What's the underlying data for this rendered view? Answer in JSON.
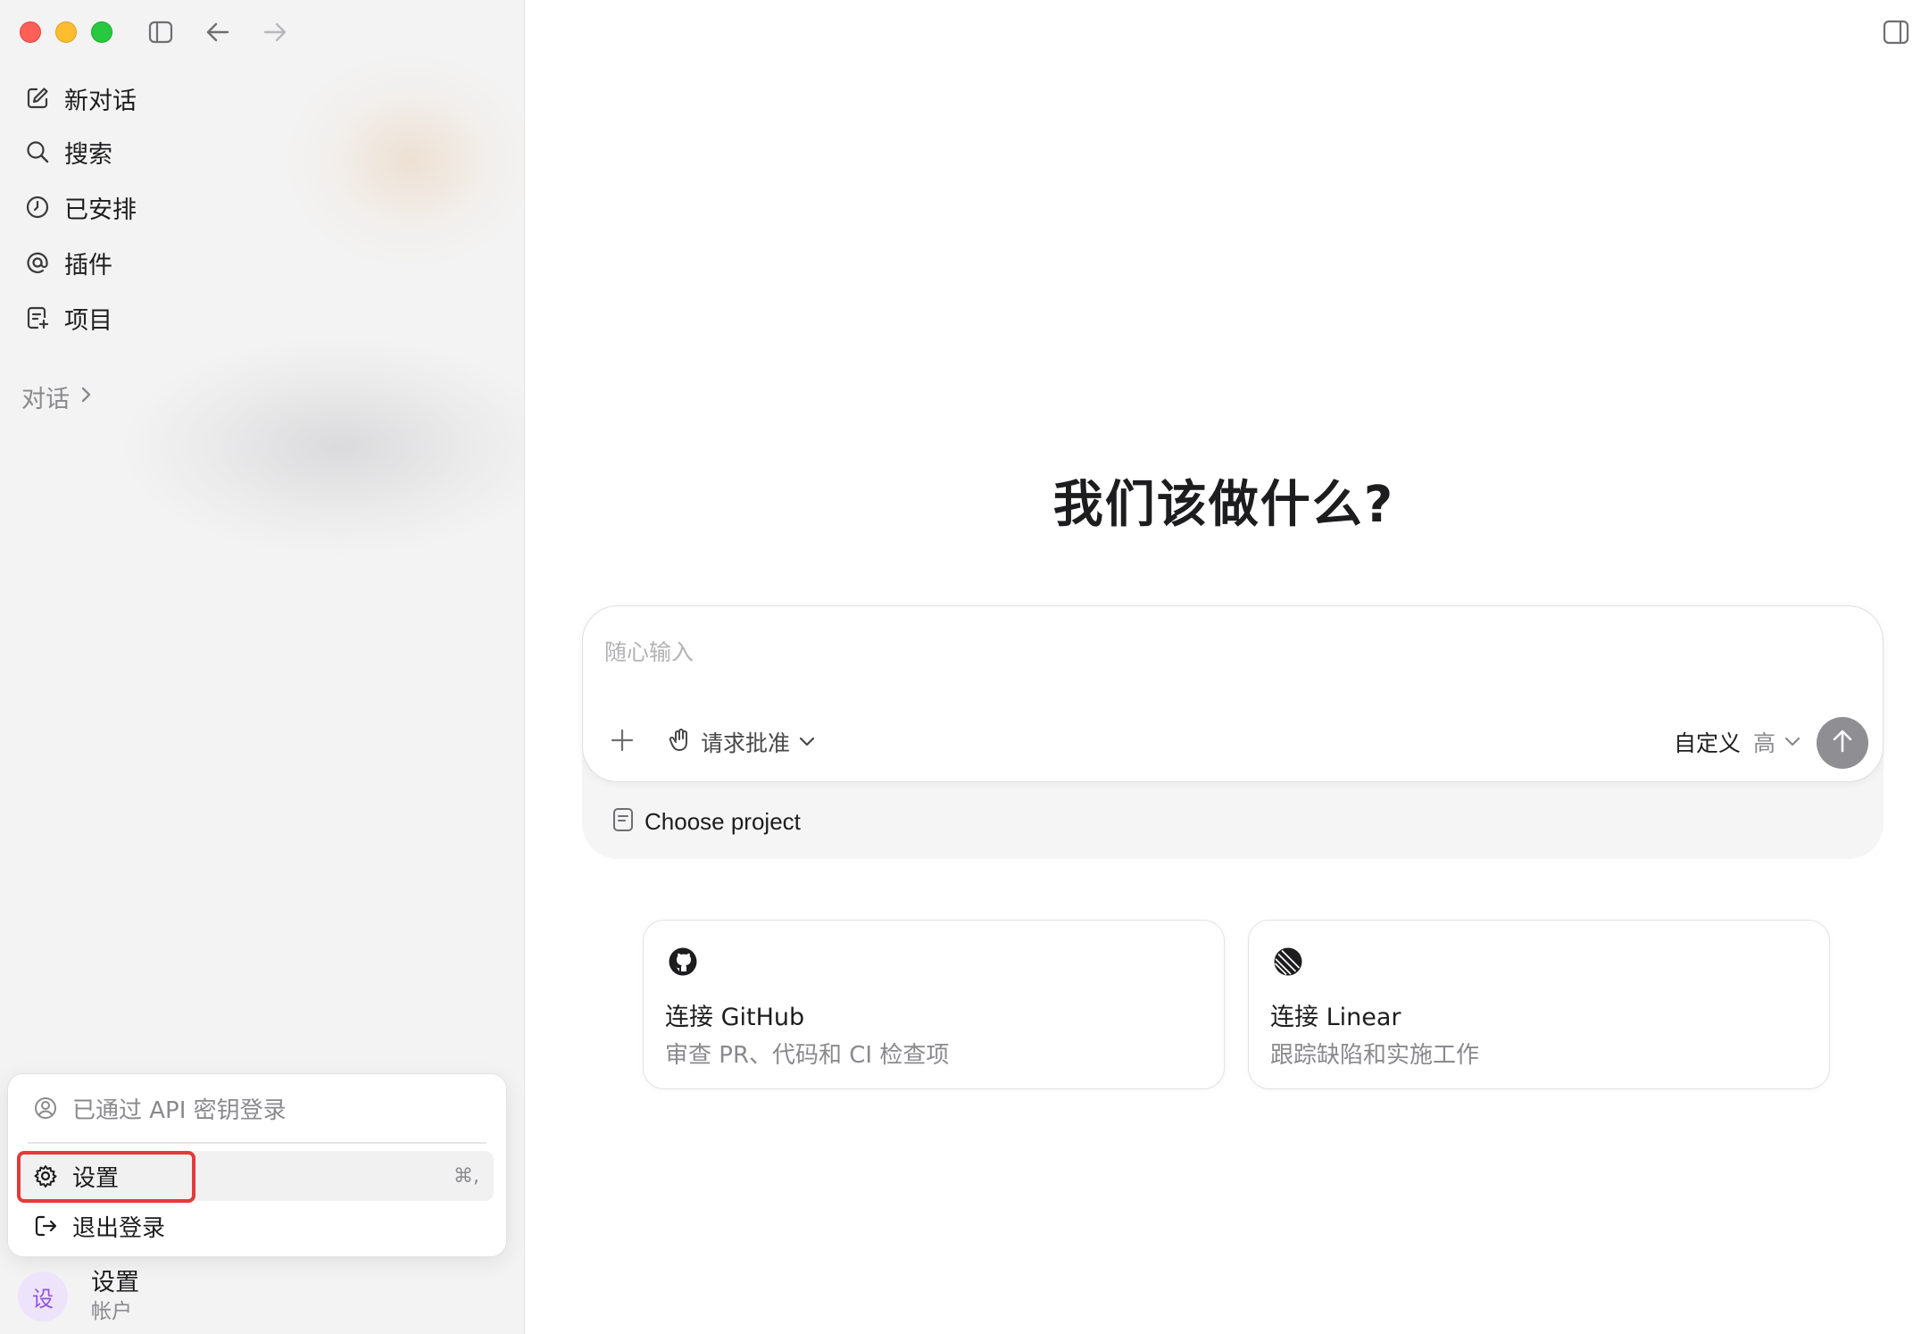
{
  "sidebar": {
    "nav": [
      {
        "label": "新对话",
        "icon": "edit-icon"
      },
      {
        "label": "搜索",
        "icon": "search-icon"
      },
      {
        "label": "已安排",
        "icon": "clock-icon"
      },
      {
        "label": "插件",
        "icon": "at-sign-icon"
      },
      {
        "label": "项目",
        "icon": "project-icon"
      }
    ],
    "section_title": "对话",
    "menu": {
      "login_status": "已通过 API 密钥登录",
      "settings_label": "设置",
      "settings_shortcut": "⌘,",
      "logout_label": "退出登录"
    },
    "account": {
      "avatar_text": "设",
      "name": "设置",
      "subtitle": "帐户"
    }
  },
  "main": {
    "headline": "我们该做什么?",
    "composer": {
      "placeholder": "随心输入",
      "approval_label": "请求批准",
      "mode_label": "自定义",
      "level_label": "高",
      "project_label": "Choose project"
    },
    "cards": [
      {
        "title": "连接 GitHub",
        "description": "审查 PR、代码和 CI 检查项",
        "icon": "github-icon"
      },
      {
        "title": "连接 Linear",
        "description": "跟踪缺陷和实施工作",
        "icon": "linear-icon"
      }
    ]
  },
  "colors": {
    "highlight": "#e5393a",
    "avatar_bg": "#ede3fb",
    "avatar_fg": "#8f55dc",
    "send_button": "#8e8e93"
  }
}
